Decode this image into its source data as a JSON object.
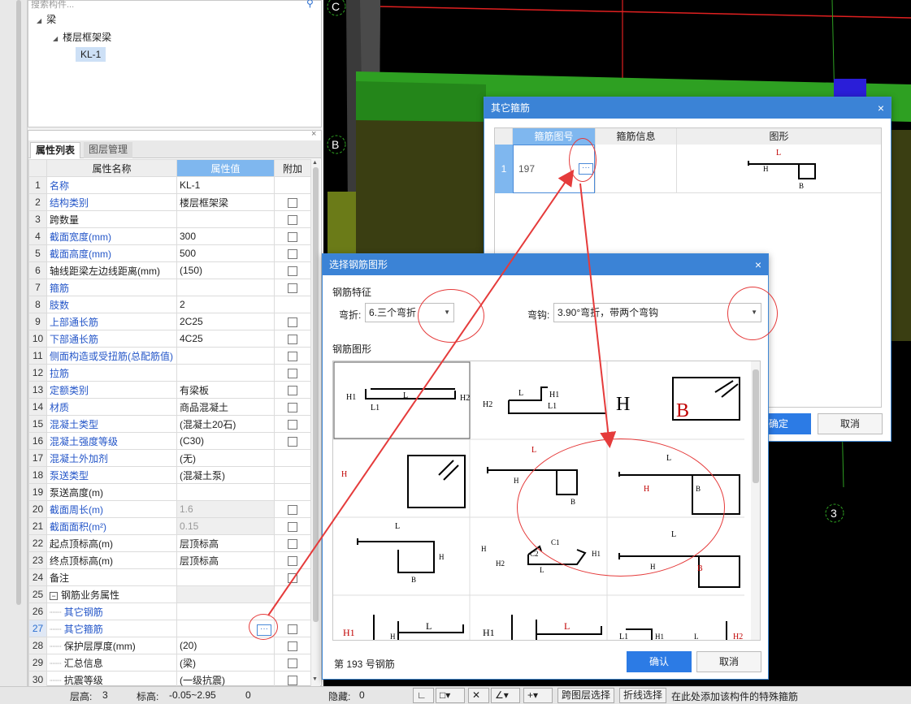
{
  "tree": {
    "search_placeholder": "搜索构件...",
    "root": "梁",
    "child": "楼层框架梁",
    "leaf": "KL-1"
  },
  "props": {
    "tabs": [
      "属性列表",
      "图层管理"
    ],
    "headers": [
      "属性名称",
      "属性值",
      "附加"
    ],
    "rows": [
      {
        "n": "1",
        "name": "名称",
        "value": "KL-1",
        "blue": true,
        "cb": false
      },
      {
        "n": "2",
        "name": "结构类别",
        "value": "楼层框架梁",
        "blue": true,
        "cb": true
      },
      {
        "n": "3",
        "name": "跨数量",
        "value": "",
        "blue": false,
        "cb": true
      },
      {
        "n": "4",
        "name": "截面宽度(mm)",
        "value": "300",
        "blue": true,
        "cb": true
      },
      {
        "n": "5",
        "name": "截面高度(mm)",
        "value": "500",
        "blue": true,
        "cb": true
      },
      {
        "n": "6",
        "name": "轴线距梁左边线距离(mm)",
        "value": "(150)",
        "blue": false,
        "cb": true
      },
      {
        "n": "7",
        "name": "箍筋",
        "value": "",
        "blue": true,
        "cb": true
      },
      {
        "n": "8",
        "name": "肢数",
        "value": "2",
        "blue": true,
        "cb": false
      },
      {
        "n": "9",
        "name": "上部通长筋",
        "value": "2C25",
        "blue": true,
        "cb": true
      },
      {
        "n": "10",
        "name": "下部通长筋",
        "value": "4C25",
        "blue": true,
        "cb": true
      },
      {
        "n": "11",
        "name": "侧面构造或受扭筋(总配筋值)",
        "value": "",
        "blue": true,
        "cb": true
      },
      {
        "n": "12",
        "name": "拉筋",
        "value": "",
        "blue": true,
        "cb": true
      },
      {
        "n": "13",
        "name": "定额类别",
        "value": "有梁板",
        "blue": true,
        "cb": true
      },
      {
        "n": "14",
        "name": "材质",
        "value": "商品混凝土",
        "blue": true,
        "cb": true
      },
      {
        "n": "15",
        "name": "混凝土类型",
        "value": "(混凝土20石)",
        "blue": true,
        "cb": true
      },
      {
        "n": "16",
        "name": "混凝土强度等级",
        "value": "(C30)",
        "blue": true,
        "cb": true
      },
      {
        "n": "17",
        "name": "混凝土外加剂",
        "value": "(无)",
        "blue": true,
        "cb": false
      },
      {
        "n": "18",
        "name": "泵送类型",
        "value": "(混凝土泵)",
        "blue": true,
        "cb": false
      },
      {
        "n": "19",
        "name": "泵送高度(m)",
        "value": "",
        "blue": false,
        "cb": false
      },
      {
        "n": "20",
        "name": "截面周长(m)",
        "value": "1.6",
        "blue": true,
        "cb": true,
        "gray": true
      },
      {
        "n": "21",
        "name": "截面面积(m²)",
        "value": "0.15",
        "blue": true,
        "cb": true,
        "gray": true
      },
      {
        "n": "22",
        "name": "起点顶标高(m)",
        "value": "层顶标高",
        "blue": false,
        "cb": true
      },
      {
        "n": "23",
        "name": "终点顶标高(m)",
        "value": "层顶标高",
        "blue": false,
        "cb": true
      },
      {
        "n": "24",
        "name": "备注",
        "value": "",
        "blue": false,
        "cb": true
      },
      {
        "n": "25",
        "name": "钢筋业务属性",
        "value": "",
        "blue": false,
        "cb": false,
        "group": true,
        "gray": true
      },
      {
        "n": "26",
        "name": "其它钢筋",
        "value": "",
        "blue": true,
        "cb": false,
        "indent": true
      },
      {
        "n": "27",
        "name": "其它箍筋",
        "value": "",
        "blue": true,
        "cb": true,
        "indent": true,
        "active": true
      },
      {
        "n": "28",
        "name": "保护层厚度(mm)",
        "value": "(20)",
        "blue": false,
        "cb": true,
        "indent": true
      },
      {
        "n": "29",
        "name": "汇总信息",
        "value": "(梁)",
        "blue": false,
        "cb": true,
        "indent": true
      },
      {
        "n": "30",
        "name": "抗震等级",
        "value": "(一级抗震)",
        "blue": false,
        "cb": true,
        "indent": true
      }
    ],
    "dots": "···"
  },
  "viewport": {
    "axis_c": "C",
    "axis_b": "B",
    "axis_3": "3"
  },
  "dlg1": {
    "title": "其它箍筋",
    "close": "×",
    "headers": [
      "箍筋图号",
      "箍筋信息",
      "图形"
    ],
    "row_num": "1",
    "code": "197",
    "dots": "···",
    "shape_labels": [
      "L",
      "H",
      "B"
    ],
    "ok": "确定",
    "cancel": "取消"
  },
  "dlg2": {
    "title": "选择钢筋图形",
    "close": "×",
    "section_feature": "钢筋特征",
    "bend_label": "弯折:",
    "bend_value": "6.三个弯折",
    "hook_label": "弯钩:",
    "hook_value": "3.90°弯折，带两个弯钩",
    "section_shape": "钢筋图形",
    "status": "第 193 号钢筋",
    "ok": "确认",
    "cancel": "取消",
    "shape_labels": {
      "s1": [
        "H1",
        "L1",
        "L",
        "H2"
      ],
      "s2": [
        "H2",
        "L",
        "H1",
        "L1"
      ],
      "s3": [
        "H",
        "B"
      ],
      "s4": [
        "H"
      ],
      "s5": [
        "L",
        "H",
        "B"
      ],
      "s6": [
        "L",
        "H",
        "B"
      ],
      "s7": [
        "L",
        "H",
        "B"
      ],
      "s8": [
        "H",
        "H2",
        "C2",
        "C1",
        "L",
        "H1"
      ],
      "s9": [
        "L",
        "H",
        "B"
      ],
      "s10": [
        "H1",
        "H",
        "L"
      ],
      "s11": [
        "H1",
        "L"
      ],
      "s12": [
        "L1",
        "H1",
        "L",
        "H2"
      ]
    }
  },
  "statusbar": {
    "floor_height_label": "层高:",
    "floor_height": "3",
    "elev_label": "标高:",
    "elev": "-0.05~2.95",
    "zero": "0",
    "hidden_label": "隐藏:",
    "hidden": "0",
    "btn_cross_floor": "跨图层选择",
    "btn_polyline": "折线选择",
    "hint": "在此处添加该构件的特殊箍筋"
  },
  "colors": {
    "accent": "#3b83d6",
    "annotation": "#e53b3b",
    "link_blue": "#2456c8",
    "beam_green": "#2ea022"
  }
}
